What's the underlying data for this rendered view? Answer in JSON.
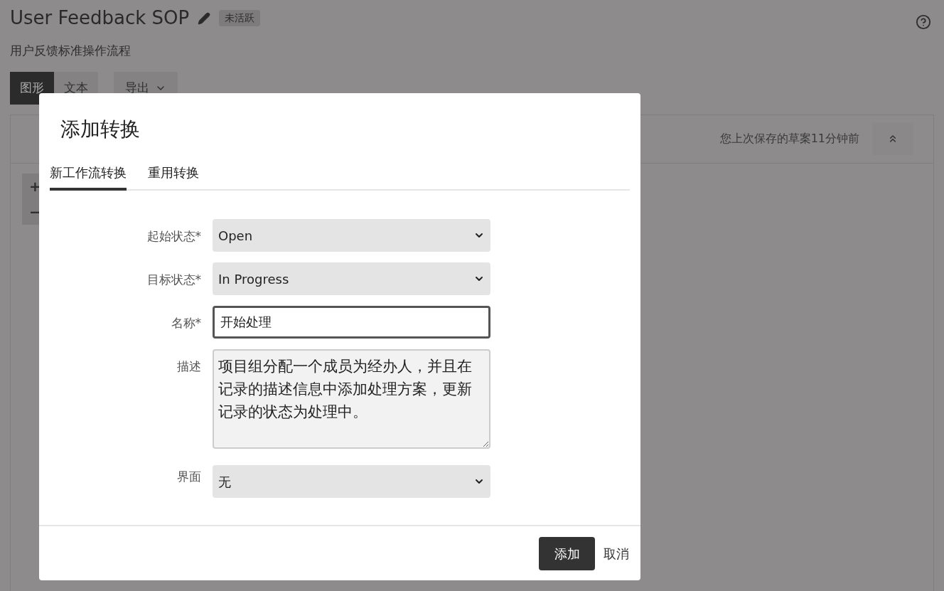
{
  "page": {
    "title": "User Feedback SOP",
    "status_badge": "未活跃",
    "description": "用户反馈标准操作流程",
    "view_tabs": [
      {
        "label": "图形",
        "selected": true
      },
      {
        "label": "文本",
        "selected": false
      }
    ],
    "export_button": "导出",
    "zoom_controls": [
      "+",
      "−"
    ],
    "draft_note": "您上次保存的草案11分钟前"
  },
  "dialog": {
    "title": "添加转换",
    "tabs": [
      {
        "label": "新工作流转换",
        "selected": true
      },
      {
        "label": "重用转换",
        "selected": false
      }
    ],
    "fields": [
      {
        "kind": "select",
        "label": "起始状态*",
        "value": "Open"
      },
      {
        "kind": "select",
        "label": "目标状态*",
        "value": "In Progress"
      },
      {
        "kind": "text",
        "label": "名称*",
        "value": "开始处理",
        "focused": true
      },
      {
        "kind": "textarea",
        "label": "描述",
        "value": "项目组分配一个成员为经办人，并且在记录的描述信息中添加处理方案，更新记录的状态为处理中。"
      },
      {
        "kind": "select",
        "label": "界面",
        "value": "无"
      }
    ],
    "primary_button": "添加",
    "cancel_link": "取消"
  }
}
